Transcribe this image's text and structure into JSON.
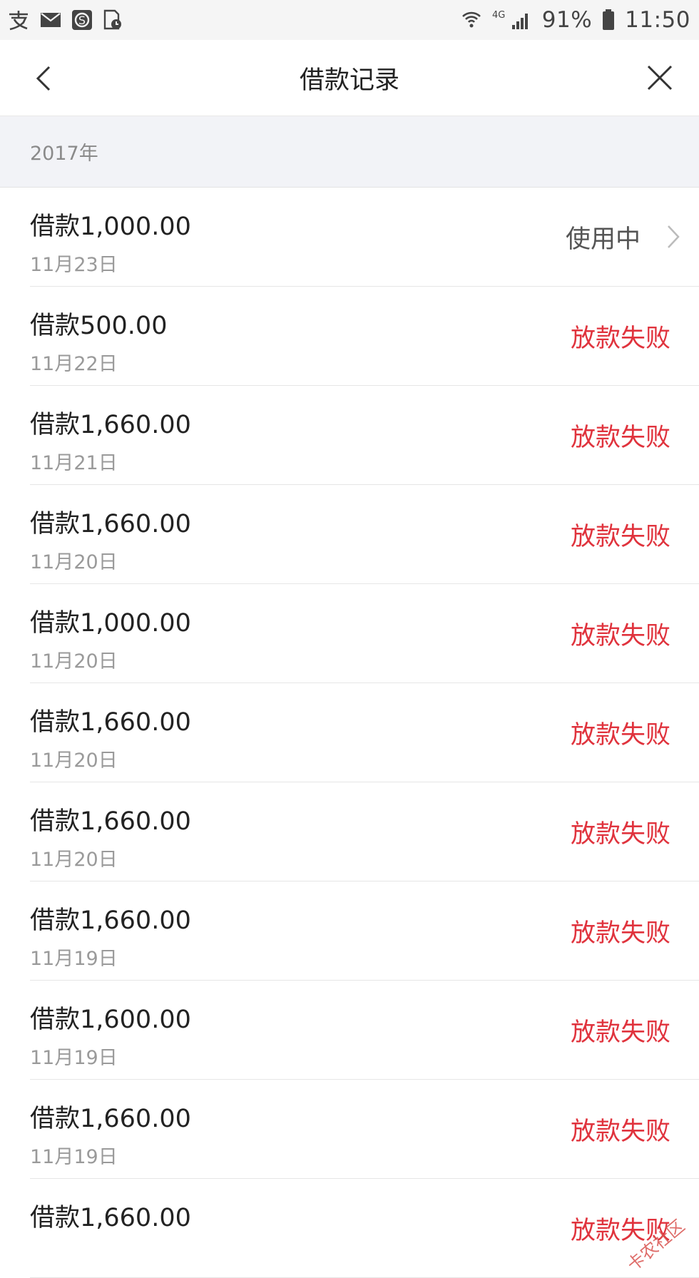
{
  "status_bar": {
    "battery": "91%",
    "time": "11:50",
    "network": "4G"
  },
  "header": {
    "title": "借款记录"
  },
  "section": {
    "year": "2017年"
  },
  "records": [
    {
      "amount": "借款1,000.00",
      "date": "11月23日",
      "status": "使用中"
    },
    {
      "amount": "借款500.00",
      "date": "11月22日",
      "status": "放款失败"
    },
    {
      "amount": "借款1,660.00",
      "date": "11月21日",
      "status": "放款失败"
    },
    {
      "amount": "借款1,660.00",
      "date": "11月20日",
      "status": "放款失败"
    },
    {
      "amount": "借款1,000.00",
      "date": "11月20日",
      "status": "放款失败"
    },
    {
      "amount": "借款1,660.00",
      "date": "11月20日",
      "status": "放款失败"
    },
    {
      "amount": "借款1,660.00",
      "date": "11月20日",
      "status": "放款失败"
    },
    {
      "amount": "借款1,660.00",
      "date": "11月19日",
      "status": "放款失败"
    },
    {
      "amount": "借款1,600.00",
      "date": "11月19日",
      "status": "放款失败"
    },
    {
      "amount": "借款1,660.00",
      "date": "11月19日",
      "status": "放款失败"
    },
    {
      "amount": "借款1,660.00",
      "date": "",
      "status": "放款失败"
    }
  ],
  "watermark": "卡农社区",
  "colors": {
    "failed": "#e0333d",
    "active": "#555555",
    "section_bg": "#f2f3f7"
  }
}
